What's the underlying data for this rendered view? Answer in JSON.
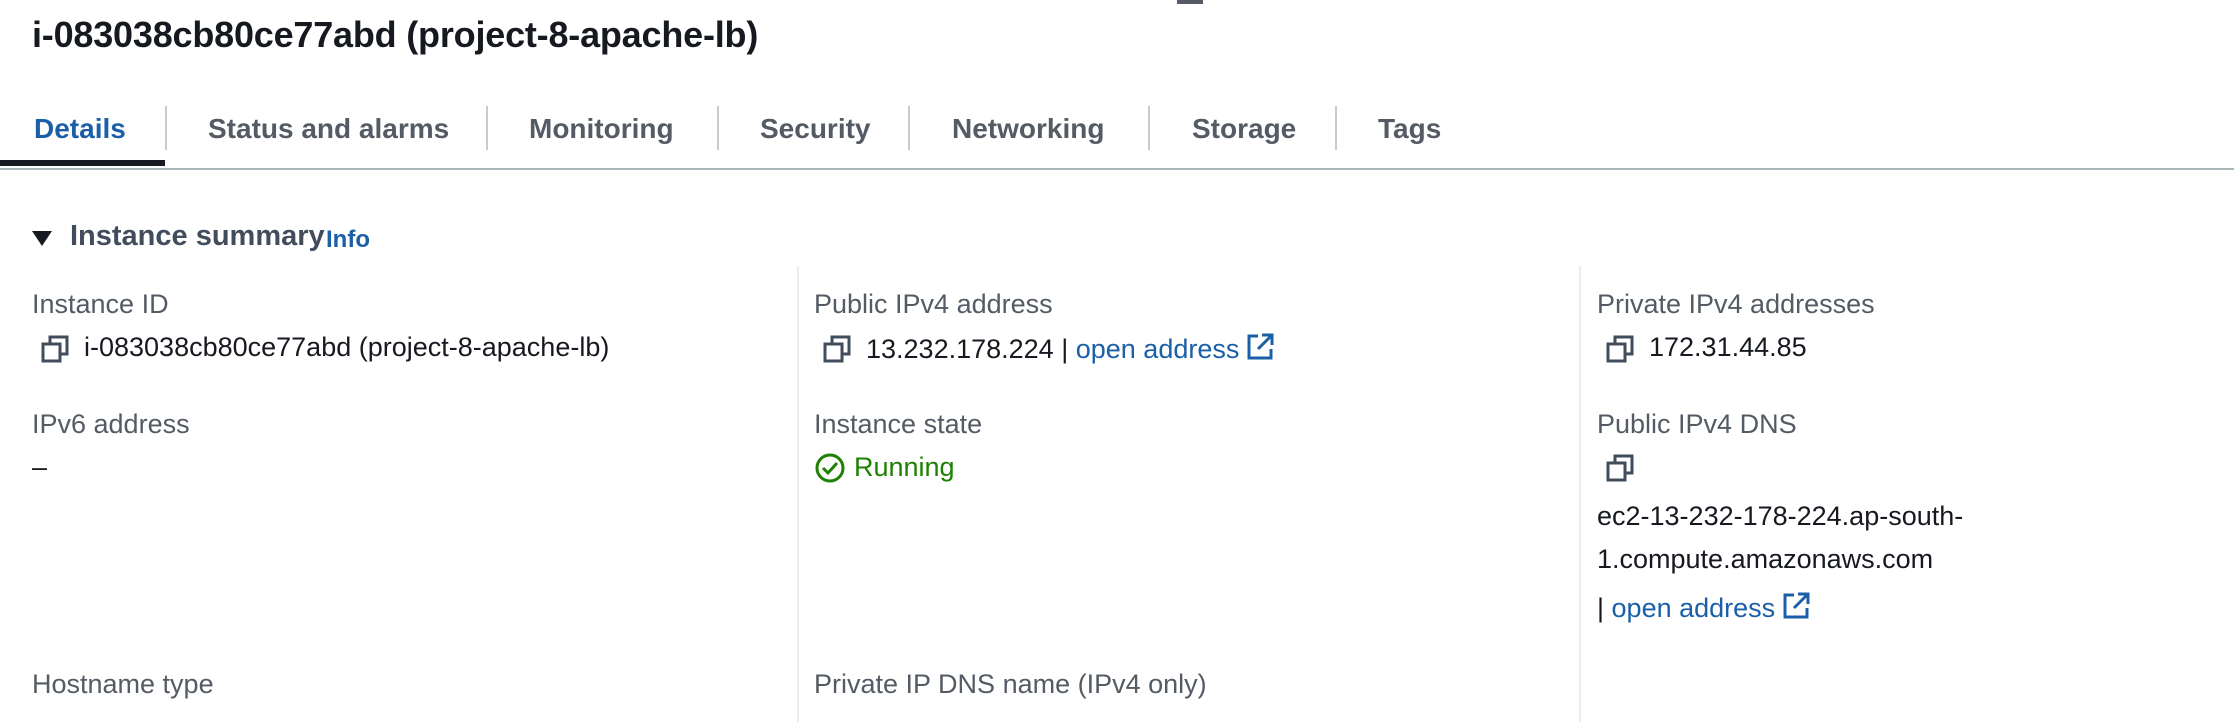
{
  "page": {
    "title": "i-083038cb80ce77abd (project-8-apache-lb)"
  },
  "tabs": [
    {
      "label": "Details",
      "active": true
    },
    {
      "label": "Status and alarms"
    },
    {
      "label": "Monitoring"
    },
    {
      "label": "Security"
    },
    {
      "label": "Networking"
    },
    {
      "label": "Storage"
    },
    {
      "label": "Tags"
    }
  ],
  "section": {
    "title": "Instance summary",
    "info_label": "Info"
  },
  "fields": {
    "instance_id": {
      "label": "Instance ID",
      "value": "i-083038cb80ce77abd (project-8-apache-lb)"
    },
    "public_ipv4": {
      "label": "Public IPv4 address",
      "value": "13.232.178.224",
      "separator": "|",
      "link": "open address"
    },
    "private_ipv4": {
      "label": "Private IPv4 addresses",
      "value": "172.31.44.85"
    },
    "ipv6": {
      "label": "IPv6 address",
      "value": "–"
    },
    "instance_state": {
      "label": "Instance state",
      "value": "Running"
    },
    "public_dns": {
      "label": "Public IPv4 DNS",
      "value_line1": "ec2-13-232-178-224.ap-south-",
      "value_line2": "1.compute.amazonaws.com",
      "separator": "|",
      "link": "open address"
    },
    "hostname_type": {
      "label": "Hostname type"
    },
    "private_dns": {
      "label": "Private IP DNS name (IPv4 only)"
    }
  },
  "colors": {
    "link": "#1a5fa8",
    "running": "#1d8102",
    "label": "#545b64",
    "text": "#16191f"
  },
  "icons": [
    "copy-icon",
    "external-link-icon",
    "check-circle-icon",
    "caret-down-icon"
  ]
}
